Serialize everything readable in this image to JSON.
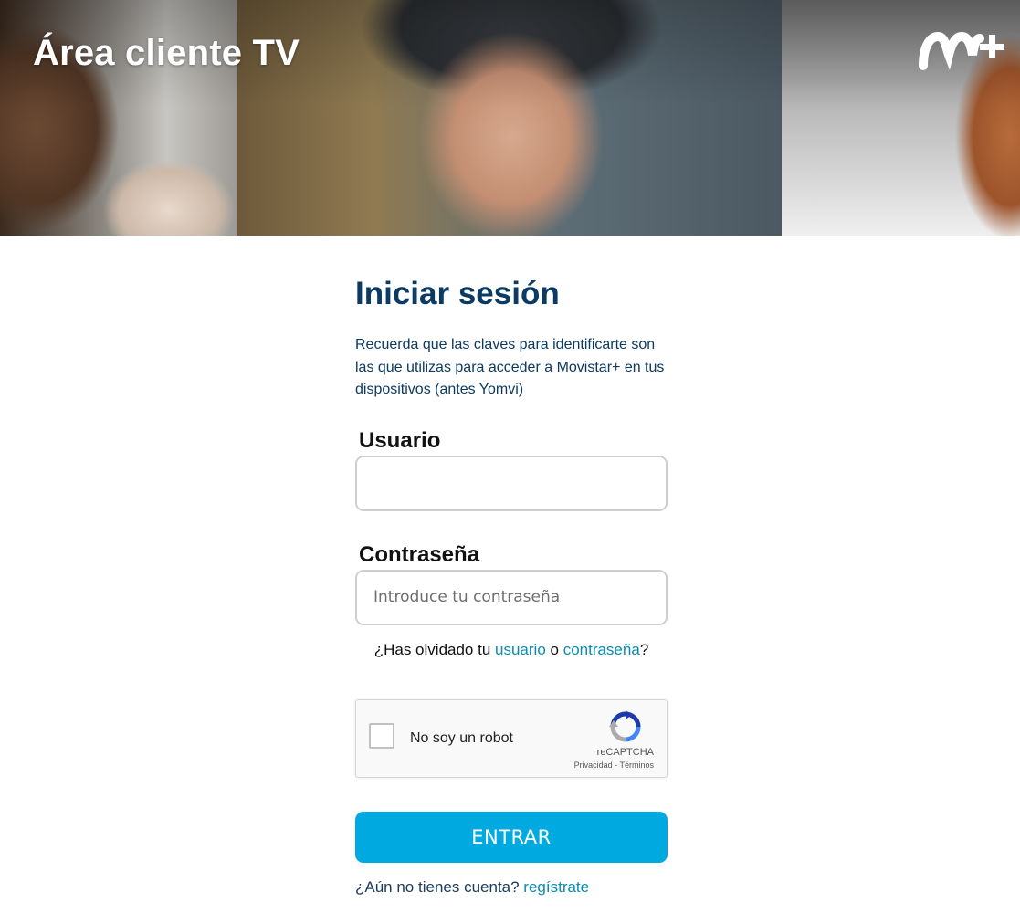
{
  "header": {
    "title": "Área cliente TV",
    "logo_icon": "movistar-plus-logo-icon"
  },
  "login": {
    "heading": "Iniciar sesión",
    "intro": "Recuerda que las claves para identificarte son las que utilizas para acceder a Movistar+ en tus dispositivos (antes Yomvi)",
    "username_label": "Usuario",
    "username_value": "",
    "username_placeholder": "",
    "password_label": "Contraseña",
    "password_placeholder": "Introduce tu contraseña",
    "forgot_prefix": "¿Has olvidado tu ",
    "forgot_user_link": "usuario",
    "forgot_or": " o ",
    "forgot_password_link": "contraseña",
    "forgot_suffix": "?",
    "submit_label": "ENTRAR",
    "register_prefix": "¿Aún no tienes cuenta? ",
    "register_link": "regístrate"
  },
  "captcha": {
    "label": "No soy un robot",
    "brand": "reCAPTCHA",
    "privacy_link": "Privacidad",
    "separator": " - ",
    "terms_link": "Términos"
  },
  "colors": {
    "heading": "#0b3a63",
    "link": "#0a8bb3",
    "button": "#00a9e0"
  }
}
